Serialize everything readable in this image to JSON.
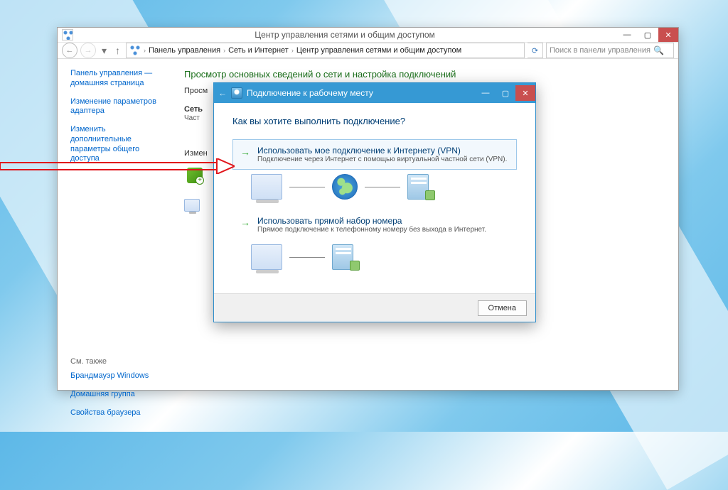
{
  "window": {
    "title": "Центр управления сетями и общим доступом",
    "ctrl_min": "—",
    "ctrl_max": "▢",
    "ctrl_close": "✕"
  },
  "nav": {
    "back": "←",
    "forward": "→",
    "up": "↑",
    "refresh": "⟳",
    "breadcrumb": [
      "Панель управления",
      "Сеть и Интернет",
      "Центр управления сетями и общим доступом"
    ],
    "dropdown": "▾"
  },
  "search": {
    "placeholder": "Поиск в панели управления"
  },
  "sidebar": {
    "items": [
      "Панель управления — домашняя страница",
      "Изменение параметров адаптера",
      "Изменить дополнительные параметры общего доступа"
    ],
    "see_also_header": "См. также",
    "see_also": [
      "Брандмауэр Windows",
      "Домашняя группа",
      "Свойства браузера"
    ]
  },
  "main": {
    "heading": "Просмотр основных сведений о сети и настройка подключений",
    "line1_prefix": "Просм",
    "section1_label": "Сеть",
    "section1_sub": "Част",
    "section2_label": "Измен"
  },
  "wizard": {
    "title": "Подключение к рабочему месту",
    "back": "←",
    "prompt": "Как вы хотите выполнить подключение?",
    "opt1_title": "Использовать мое подключение к Интернету (VPN)",
    "opt1_sub": "Подключение через Интернет с помощью виртуальной частной сети (VPN).",
    "opt2_title": "Использовать прямой набор номера",
    "opt2_sub": "Прямое подключение к телефонному номеру без выхода в Интернет.",
    "cancel": "Отмена",
    "ctrl_min": "—",
    "ctrl_max": "▢",
    "ctrl_close": "✕"
  }
}
